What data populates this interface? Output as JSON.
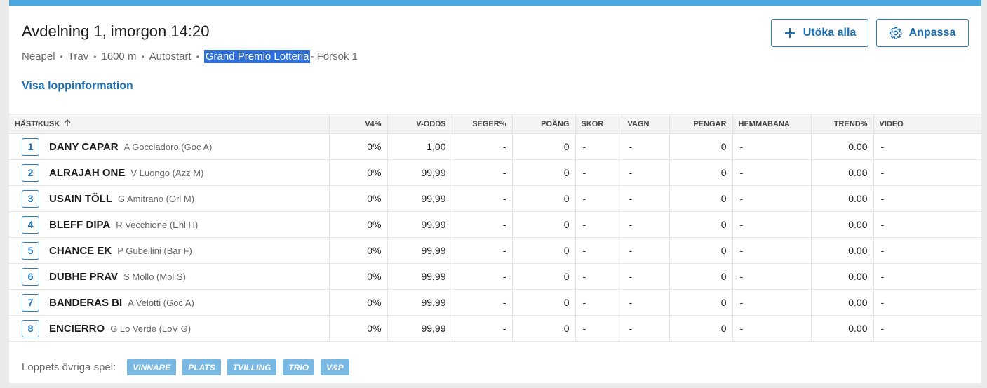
{
  "header": {
    "title": "Avdelning 1,  imorgon 14:20",
    "meta": {
      "track": "Neapel",
      "type": "Trav",
      "distance": "1600 m",
      "start": "Autostart",
      "race_name": "Grand Premio Lotteria",
      "heat": "- Försök 1"
    },
    "info_link": "Visa loppinformation",
    "expand_button": "Utöka alla",
    "customize_button": "Anpassa"
  },
  "table": {
    "columns": {
      "horse": "HÄST/KUSK",
      "v4": "V4%",
      "vodds": "V-ODDS",
      "win": "SEGER%",
      "points": "POÄNG",
      "shoes": "SKOR",
      "cart": "VAGN",
      "money": "PENGAR",
      "home": "HEMMABANA",
      "trend": "TREND%",
      "video": "VIDEO"
    },
    "rows": [
      {
        "num": "1",
        "horse": "DANY CAPAR",
        "driver": "A Gocciadoro (Goc A)",
        "v4": "0%",
        "vodds": "1,00",
        "win": "-",
        "points": "0",
        "shoes": "-",
        "cart": "-",
        "money": "0",
        "home": "-",
        "trend": "0.00",
        "video": "-"
      },
      {
        "num": "2",
        "horse": "ALRAJAH ONE",
        "driver": "V Luongo (Azz M)",
        "v4": "0%",
        "vodds": "99,99",
        "win": "-",
        "points": "0",
        "shoes": "-",
        "cart": "-",
        "money": "0",
        "home": "-",
        "trend": "0.00",
        "video": "-"
      },
      {
        "num": "3",
        "horse": "USAIN TÖLL",
        "driver": "G Amitrano (Orl M)",
        "v4": "0%",
        "vodds": "99,99",
        "win": "-",
        "points": "0",
        "shoes": "-",
        "cart": "-",
        "money": "0",
        "home": "-",
        "trend": "0.00",
        "video": "-"
      },
      {
        "num": "4",
        "horse": "BLEFF DIPA",
        "driver": "R Vecchione (Ehl H)",
        "v4": "0%",
        "vodds": "99,99",
        "win": "-",
        "points": "0",
        "shoes": "-",
        "cart": "-",
        "money": "0",
        "home": "-",
        "trend": "0.00",
        "video": "-"
      },
      {
        "num": "5",
        "horse": "CHANCE EK",
        "driver": "P Gubellini (Bar F)",
        "v4": "0%",
        "vodds": "99,99",
        "win": "-",
        "points": "0",
        "shoes": "-",
        "cart": "-",
        "money": "0",
        "home": "-",
        "trend": "0.00",
        "video": "-"
      },
      {
        "num": "6",
        "horse": "DUBHE PRAV",
        "driver": "S Mollo (Mol S)",
        "v4": "0%",
        "vodds": "99,99",
        "win": "-",
        "points": "0",
        "shoes": "-",
        "cart": "-",
        "money": "0",
        "home": "-",
        "trend": "0.00",
        "video": "-"
      },
      {
        "num": "7",
        "horse": "BANDERAS BI",
        "driver": "A Velotti (Goc A)",
        "v4": "0%",
        "vodds": "99,99",
        "win": "-",
        "points": "0",
        "shoes": "-",
        "cart": "-",
        "money": "0",
        "home": "-",
        "trend": "0.00",
        "video": "-"
      },
      {
        "num": "8",
        "horse": "ENCIERRO",
        "driver": "G Lo Verde (LoV G)",
        "v4": "0%",
        "vodds": "99,99",
        "win": "-",
        "points": "0",
        "shoes": "-",
        "cart": "-",
        "money": "0",
        "home": "-",
        "trend": "0.00",
        "video": "-"
      }
    ]
  },
  "footer": {
    "label": "Loppets övriga spel:",
    "games": [
      "VINNARE",
      "PLATS",
      "TVILLING",
      "TRIO",
      "V&P"
    ]
  },
  "colors": {
    "accent_bar": "#4ba6dd",
    "link": "#1b6fb4",
    "badge": "#7ab8e4",
    "highlight": "#2f6fd8"
  }
}
